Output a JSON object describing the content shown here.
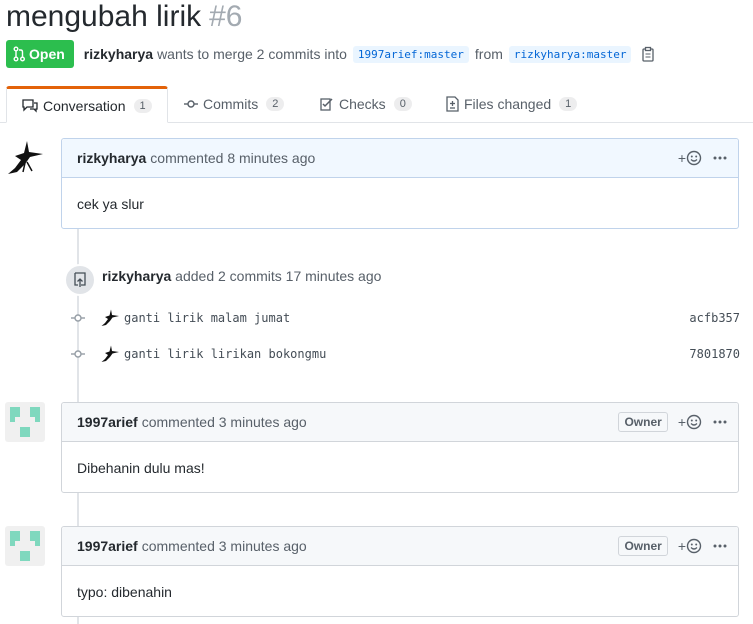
{
  "pr": {
    "title": "mengubah lirik",
    "number": "#6",
    "state": "Open",
    "author": "rizkyharya",
    "merge_text": "wants to merge 2 commits into",
    "base_branch": "1997arief:master",
    "from_text": "from",
    "head_branch": "rizkyharya:master"
  },
  "tabs": [
    {
      "label": "Conversation",
      "count": "1",
      "icon": "conversation-icon"
    },
    {
      "label": "Commits",
      "count": "2",
      "icon": "commit-icon"
    },
    {
      "label": "Checks",
      "count": "0",
      "icon": "checks-icon"
    },
    {
      "label": "Files changed",
      "count": "1",
      "icon": "files-icon"
    }
  ],
  "timeline": {
    "comment1": {
      "author": "rizkyharya",
      "meta": "commented 8 minutes ago",
      "body": "cek ya slur"
    },
    "commits_event": {
      "author": "rizkyharya",
      "text": "added 2 commits 17 minutes ago",
      "commits": [
        {
          "message": "ganti lirik malam jumat",
          "sha": "acfb357"
        },
        {
          "message": "ganti lirik lirikan bokongmu",
          "sha": "7801870"
        }
      ]
    },
    "comment2": {
      "author": "1997arief",
      "meta": "commented 3 minutes ago",
      "role": "Owner",
      "body": "Dibehanin dulu mas!"
    },
    "comment3": {
      "author": "1997arief",
      "meta": "commented 3 minutes ago",
      "role": "Owner",
      "body": "typo: dibenahin"
    }
  },
  "colors": {
    "open_badge": "#2cbe4e",
    "active_tab_accent": "#e36209",
    "branch_bg": "#eaf5ff",
    "branch_fg": "#0366d6",
    "identicon": "#7fd8be"
  }
}
